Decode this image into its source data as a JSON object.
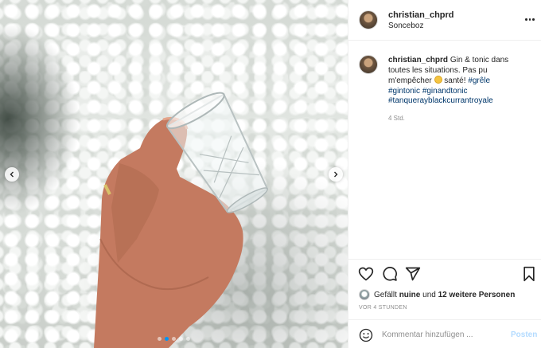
{
  "post": {
    "username": "christian_chprd",
    "location": "Sonceboz",
    "caption": {
      "username": "christian_chprd",
      "text_before_emoji": "Gin & tonic dans toutes les situations. Pas pu m'empêcher",
      "text_after_emoji": "santé!",
      "hashtags": [
        "#grêle",
        "#gintonic",
        "#ginandtonic",
        "#tanquerayblackcurrantroyale"
      ],
      "time": "4 Std."
    },
    "likes": {
      "prefix": "Gefällt",
      "user": "nuine",
      "middle": "und",
      "others": "12 weitere Personen"
    },
    "timestamp": "VOR 4 STUNDEN",
    "comment": {
      "placeholder": "Kommentar hinzufügen ...",
      "post_label": "Posten"
    },
    "carousel": {
      "count": 5,
      "active_index": 1
    }
  },
  "colors": {
    "accent": "#0095f6",
    "post_button_disabled": "#b3dbff",
    "hashtag": "#00376b",
    "muted": "#8e8e8e"
  },
  "icons": [
    "chevron-left-icon",
    "chevron-right-icon",
    "more-icon",
    "heart-icon",
    "comment-icon",
    "share-icon",
    "bookmark-icon",
    "smile-icon"
  ]
}
